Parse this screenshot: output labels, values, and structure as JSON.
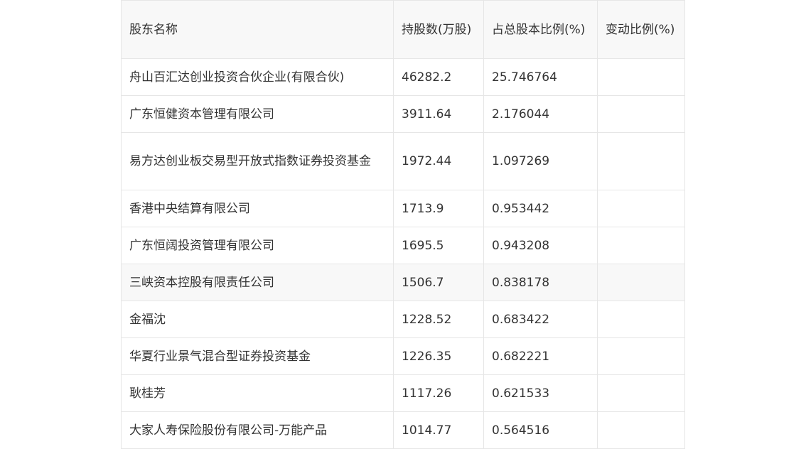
{
  "table": {
    "headers": [
      "股东名称",
      "持股数(万股)",
      "占总股本比例(%)",
      "变动比例(%)"
    ],
    "rows": [
      [
        "舟山百汇达创业投资合伙企业(有限合伙)",
        "46282.2",
        "25.746764",
        ""
      ],
      [
        "广东恒健资本管理有限公司",
        "3911.64",
        "2.176044",
        ""
      ],
      [
        "易方达创业板交易型开放式指数证券投资基金",
        "1972.44",
        "1.097269",
        ""
      ],
      [
        "香港中央结算有限公司",
        "1713.9",
        "0.953442",
        ""
      ],
      [
        "广东恒阔投资管理有限公司",
        "1695.5",
        "0.943208",
        ""
      ],
      [
        "三峡资本控股有限责任公司",
        "1506.7",
        "0.838178",
        ""
      ],
      [
        "金福沈",
        "1228.52",
        "0.683422",
        ""
      ],
      [
        "华夏行业景气混合型证券投资基金",
        "1226.35",
        "0.682221",
        ""
      ],
      [
        "耿桂芳",
        "1117.26",
        "0.621533",
        ""
      ],
      [
        "大家人寿保险股份有限公司-万能产品",
        "1014.77",
        "0.564516",
        ""
      ]
    ]
  }
}
